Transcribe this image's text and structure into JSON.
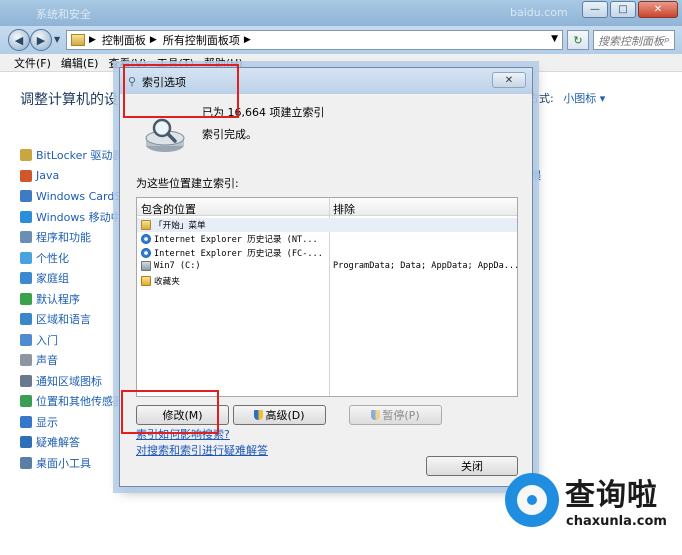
{
  "window": {
    "title_blurred": "系统和安全",
    "title_right_blurred": "baidu.com",
    "controls": {
      "minimize": "—",
      "maximize": "□",
      "close": "✕"
    }
  },
  "nav": {
    "back": "◀",
    "forward": "▶",
    "address": [
      "控制面板",
      "所有控制面板项"
    ],
    "separator": "▶",
    "refresh": "↻",
    "search_placeholder": "搜索控制面板"
  },
  "menubar": {
    "items": [
      "文件(F)",
      "编辑(E)",
      "查看(V)",
      "工具(T)",
      "帮助(H)"
    ]
  },
  "content": {
    "header": "调整计算机的设置",
    "view_label": "方式:",
    "view_value": "小图标 ▾",
    "right_fragment": "喂",
    "items": [
      {
        "label": "BitLocker 驱动器加",
        "color": "#c9a640"
      },
      {
        "label": "Java",
        "color": "#d0562b"
      },
      {
        "label": "Windows CardSp",
        "color": "#3d7bc4"
      },
      {
        "label": "Windows 移动中心",
        "color": "#2c8ed8"
      },
      {
        "label": "程序和功能",
        "color": "#6a8fb5"
      },
      {
        "label": "个性化",
        "color": "#4aa3df"
      },
      {
        "label": "家庭组",
        "color": "#3b8ad1"
      },
      {
        "label": "默认程序",
        "color": "#39a24a"
      },
      {
        "label": "区域和语言",
        "color": "#3a87c9"
      },
      {
        "label": "入门",
        "color": "#4e8bd0"
      },
      {
        "label": "声音",
        "color": "#8c96a0"
      },
      {
        "label": "通知区域图标",
        "color": "#697a8d"
      },
      {
        "label": "位置和其他传感器",
        "color": "#3a9f55"
      },
      {
        "label": "显示",
        "color": "#3578c7"
      },
      {
        "label": "疑难解答",
        "color": "#2f6fb8"
      },
      {
        "label": "桌面小工具",
        "color": "#5b7ea6"
      }
    ]
  },
  "dialog": {
    "title": "索引选项",
    "close": "✕",
    "count_text": "已为 16,664 项建立索引",
    "status_text": "索引完成。",
    "locations_label": "为这些位置建立索引:",
    "col_included": "包含的位置",
    "col_excluded": "排除",
    "rows": [
      {
        "icon": "folder",
        "included": "「开始」菜单",
        "excluded": ""
      },
      {
        "icon": "ie",
        "included": "Internet Explorer 历史记录 (NT...",
        "excluded": ""
      },
      {
        "icon": "ie",
        "included": "Internet Explorer 历史记录 (FC-...",
        "excluded": ""
      },
      {
        "icon": "drive",
        "included": "Win7 (C:)",
        "excluded": "ProgramData; Data; AppData; AppDa..."
      },
      {
        "icon": "star",
        "included": "收藏夹",
        "excluded": ""
      }
    ],
    "btn_modify": "修改(M)",
    "btn_advanced": "高级(D)",
    "btn_pause": "暂停(P)",
    "link_howto": "索引如何影响搜索?",
    "link_troubleshoot": "对搜索和索引进行疑难解答",
    "btn_close": "关闭"
  },
  "watermark": {
    "brand": "查询啦",
    "domain": "chaxunla.com"
  },
  "colors": {
    "annotation_red": "#e02020",
    "link_blue": "#1a56b8",
    "watermark_blue": "#1f8de0"
  }
}
